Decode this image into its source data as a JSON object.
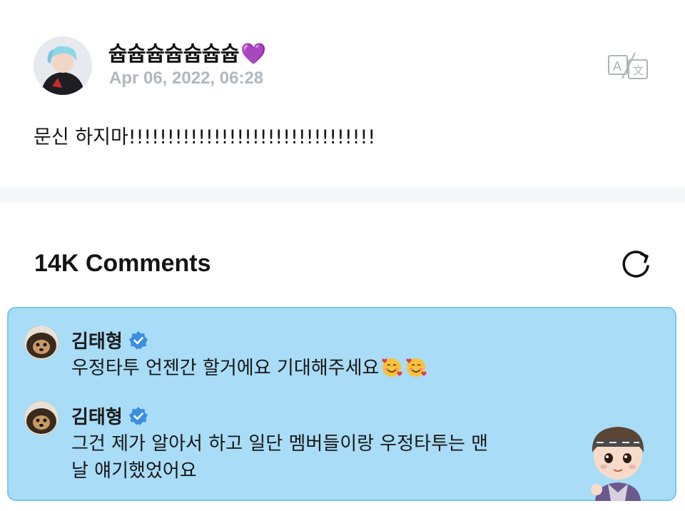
{
  "post": {
    "author": "슙슙슙슙슙슙슙",
    "author_emoji": "💜",
    "date": "Apr 06, 2022, 06:28",
    "text": "문신 하지마!!!!!!!!!!!!!!!!!!!!!!!!!!!!!!!!"
  },
  "icons": {
    "translate": "translate-icon",
    "refresh": "refresh-icon",
    "verified": "verified-badge-icon",
    "emoji": "smiling-face-with-hearts-icon"
  },
  "comments": {
    "title": "14K Comments",
    "items": [
      {
        "author": "김태형",
        "text": "우정타투 언젠간 할거에요 기대해주세요"
      },
      {
        "author": "김태형",
        "text_line1": "그건 제가 알아서 하고 일단 멤버들이랑 우정타투는 맨",
        "text_line2": "날 얘기했었어요"
      }
    ]
  },
  "colors": {
    "pinned_bg": "#a9dcf6",
    "pinned_border": "#7cc7ec",
    "verified_blue": "#3b8fe0",
    "date_gray": "#b2b7bf"
  }
}
